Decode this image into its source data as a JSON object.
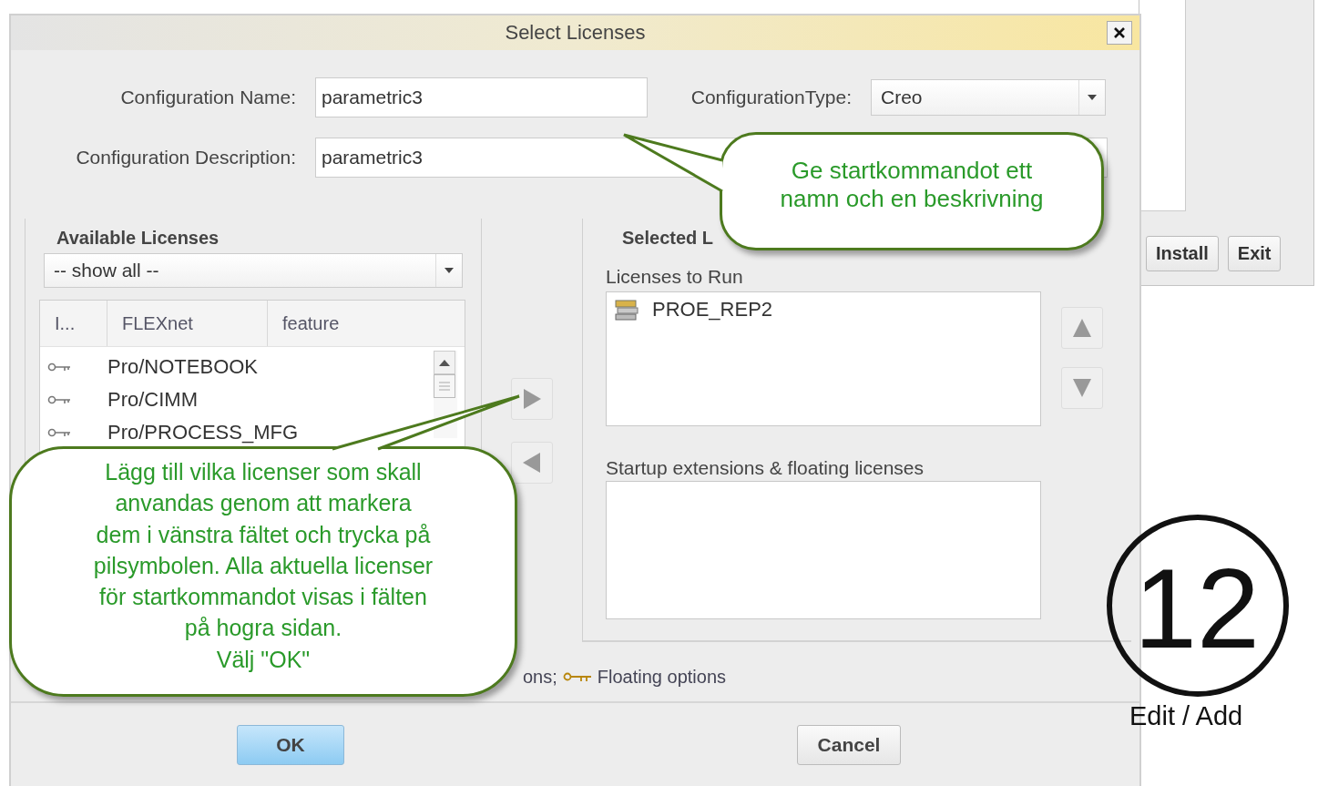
{
  "background_window": {
    "buttons": [
      "Install",
      "Exit"
    ]
  },
  "window": {
    "title": "Select Licenses"
  },
  "form": {
    "name_label": "Configuration Name:",
    "name_value": "parametric3",
    "type_label": "ConfigurationType:",
    "type_value": "Creo",
    "description_label": "Configuration Description:",
    "description_value": "parametric3"
  },
  "available": {
    "title": "Available Licenses",
    "filter": "-- show all --",
    "columns": [
      "I...",
      "FLEXnet",
      "feature"
    ],
    "rows": [
      {
        "name": "Pro/NOTEBOOK"
      },
      {
        "name": "Pro/CIMM"
      },
      {
        "name": "Pro/PROCESS_MFG"
      }
    ]
  },
  "selected": {
    "title": "Selected L",
    "run_label": "Licenses to Run",
    "run_items": [
      "PROE_REP2"
    ],
    "startup_label": "Startup extensions & floating licenses"
  },
  "legend": {
    "text_before": "ons;",
    "text_after": "Floating options"
  },
  "buttons": [
    {
      "label": "OK",
      "default": true
    },
    {
      "label": "Cancel",
      "default": false
    }
  ],
  "callouts": [
    {
      "text": "Ge startkommandot ett\nnamn och en beskrivning"
    },
    {
      "text": "Lägg till vilka licenser som skall\nanvandas genom att markera\ndem i vänstra fältet och trycka på\npilsymbolen. Alla aktuella licenser\nför startkommandot visas i fälten\npå hogra sidan.\nVälj \"OK\""
    }
  ],
  "step": {
    "number": "12",
    "caption": "Edit / Add"
  }
}
